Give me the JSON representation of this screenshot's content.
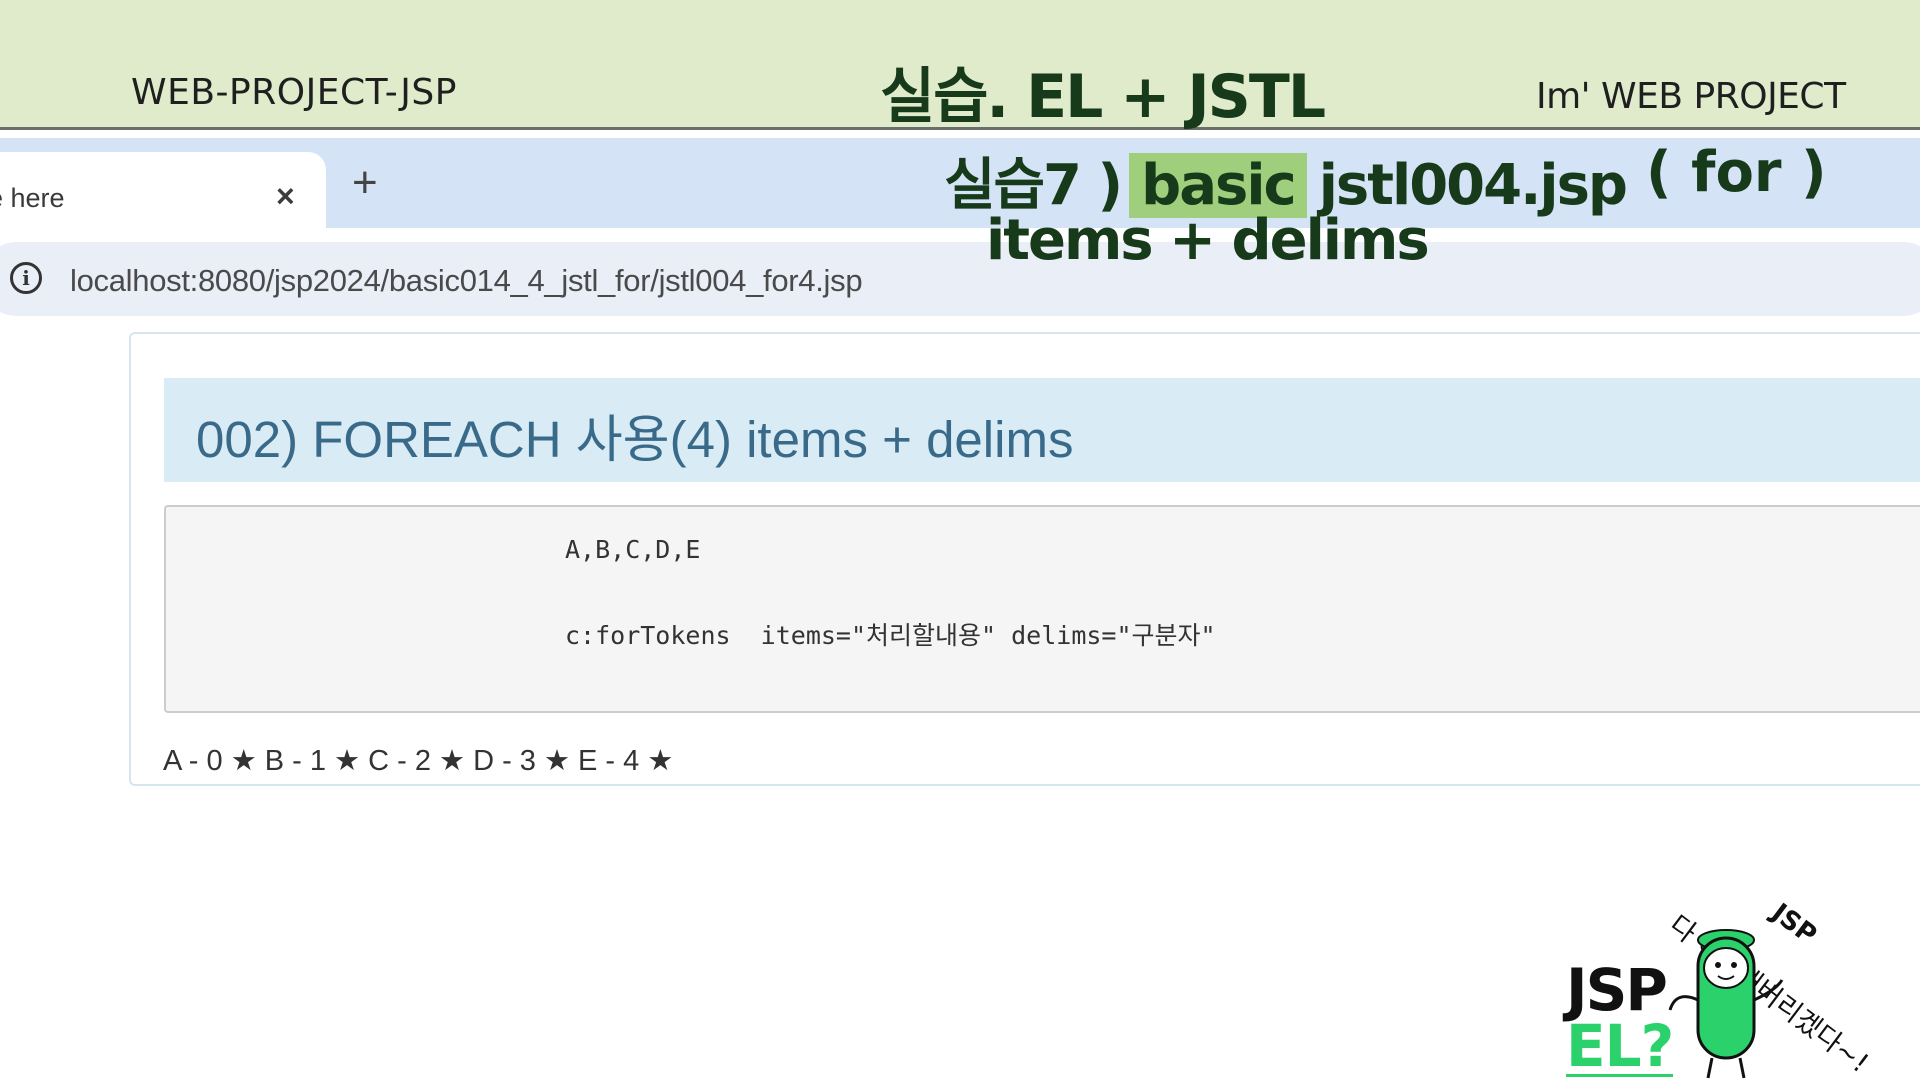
{
  "slide": {
    "left_title": "WEB-PROJECT-JSP",
    "center_title": "실습. EL + JSTL",
    "right_title": "Im'  WEB PROJECT"
  },
  "browser": {
    "tab_title": "e here",
    "tab_close": "×",
    "new_tab": "+",
    "url": "localhost:8080/jsp2024/basic014_4_jstl_for/jstl004_for4.jsp"
  },
  "overlay": {
    "prefix": "실습7 )",
    "badge": "basic",
    "file": "jstl004.jsp",
    "for_label": "( for )",
    "subtitle": "items + delims"
  },
  "page": {
    "heading": "002) FOREACH 사용(4) items + delims",
    "code_line1": "A,B,C,D,E",
    "code_line2": "c:forTokens  items=\"처리할내용\" delims=\"구분자\"",
    "result": "A - 0 ★ B - 1 ★ C - 2 ★ D - 3 ★ E - 4 ★"
  },
  "decor": {
    "jsp": "JSP",
    "el": "EL?",
    "tag_small": "다 이해해버리겠다~!",
    "tag_jsp": "JSP"
  },
  "colors": {
    "header_bg": "#dfebcb",
    "tabstrip_bg": "#d5e3f7",
    "badge_bg": "#9fcf7d",
    "jumbotron_bg": "#d9ebf5",
    "heading_text": "#3a6a8a",
    "mascot_green": "#2bd16a"
  }
}
